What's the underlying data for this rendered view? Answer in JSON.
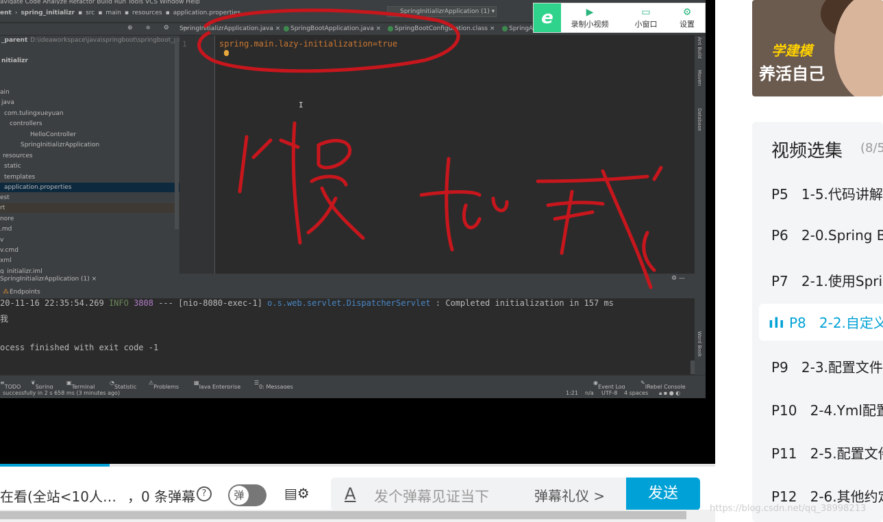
{
  "ide": {
    "menubar": "avigate  Code  Analyze  Refactor  Build  Run  Tools  VCS  Window  Help",
    "breadcrumb": [
      "ent",
      "spring_initializr",
      "src",
      "main",
      "resources",
      "application.properties"
    ],
    "run_config": "SpringInitializrApplication (1)",
    "editor_tabs": [
      "SpringInitializrApplication.java",
      "SpringBootApplication.java",
      "SpringBootConfiguration.class",
      "SpringA"
    ],
    "project_tree": [
      {
        "label": "_parent",
        "extra": "D:\\ideaworkspace\\java\\springboot\\springboot_parent",
        "indent": 2
      },
      {
        "label": "nitializr",
        "extra": "",
        "indent": 2
      },
      {
        "label": "ain",
        "extra": "",
        "indent": 0
      },
      {
        "label": "java",
        "extra": "",
        "indent": 2
      },
      {
        "label": "com.tulingxueyuan",
        "extra": "",
        "indent": 6
      },
      {
        "label": "controllers",
        "extra": "",
        "indent": 14
      },
      {
        "label": "HelloController",
        "extra": "",
        "indent": 44
      },
      {
        "label": "SpringInitializrApplication",
        "extra": "",
        "indent": 30
      },
      {
        "label": "resources",
        "extra": "",
        "indent": 4
      },
      {
        "label": "static",
        "extra": "",
        "indent": 6
      },
      {
        "label": "templates",
        "extra": "",
        "indent": 6
      },
      {
        "label": "application.properties",
        "extra": "",
        "indent": 6
      },
      {
        "label": "est",
        "extra": "",
        "indent": 0
      },
      {
        "label": "rt",
        "extra": "",
        "indent": 0
      },
      {
        "label": "nore",
        "extra": "",
        "indent": 0
      },
      {
        "label": ".md",
        "extra": "",
        "indent": 0
      },
      {
        "label": "v",
        "extra": "",
        "indent": 0
      },
      {
        "label": "v.cmd",
        "extra": "",
        "indent": 0
      },
      {
        "label": "xml",
        "extra": "",
        "indent": 0
      },
      {
        "label": "g_initializr.iml",
        "extra": "",
        "indent": 0
      }
    ],
    "line_number": "1",
    "code_key": "spring.main.lazy-initialization",
    "code_eq": "=",
    "code_value": "true",
    "run_tab": "SpringInitializrApplication (1)",
    "endpoints": "Endpoints",
    "console_lines": [
      "20-11-16 22:35:54.269  INFO 3808 --- [nio-8080-exec-1] o.s.web.servlet.DispatcherServlet        : Completed initialization in 157 ms",
      "我",
      "",
      "ocess finished with exit code -1"
    ],
    "tool_windows": [
      "TODO",
      "Spring",
      "Terminal",
      "Statistic",
      "Problems",
      "Java Enterprise",
      "0: Messages",
      "Event Log",
      "JRebel Console"
    ],
    "status_left": "successfully in 2 s 658 ms (3 minutes ago)",
    "status_right": [
      "1:21",
      "n/a",
      "UTF-8",
      "4 spaces"
    ],
    "right_strip": [
      "Ant Build",
      "Maven",
      "Database",
      "Word Book"
    ]
  },
  "overlay": {
    "record_label": "录制小视频",
    "mini_label": "小窗口",
    "settings_label": "设置"
  },
  "player": {
    "viewers": "在看(全站<10人…",
    "danmaku_count": "，0 条弹幕",
    "toggle_label": "弹",
    "input_placeholder": "发个弹幕见证当下",
    "etiquette": "弹幕礼仪 >",
    "send": "发送",
    "progress": 0.153
  },
  "ad": {
    "line1": "学建模",
    "line2": "养活自己"
  },
  "playlist": {
    "title": "视频选集",
    "count": "(8/5",
    "episodes": [
      {
        "num": "P5",
        "title": "1-5.代码讲解"
      },
      {
        "num": "P6",
        "title": "2-0.Spring B"
      },
      {
        "num": "P7",
        "title": "2-1.使用Spri"
      },
      {
        "num": "P8",
        "title": "2-2.自定义"
      },
      {
        "num": "P9",
        "title": "2-3.配置文件"
      },
      {
        "num": "P10",
        "title": "2-4.Yml配置"
      },
      {
        "num": "P11",
        "title": "2-5.配置文件"
      },
      {
        "num": "P12",
        "title": "2-6.其他约定"
      }
    ],
    "active_index": 3
  },
  "watermark": "https://blog.csdn.net/qq_38998213",
  "colors": {
    "accent": "#00a1d6",
    "ink": "#c8161d",
    "overlay_green": "#2fd38c"
  }
}
